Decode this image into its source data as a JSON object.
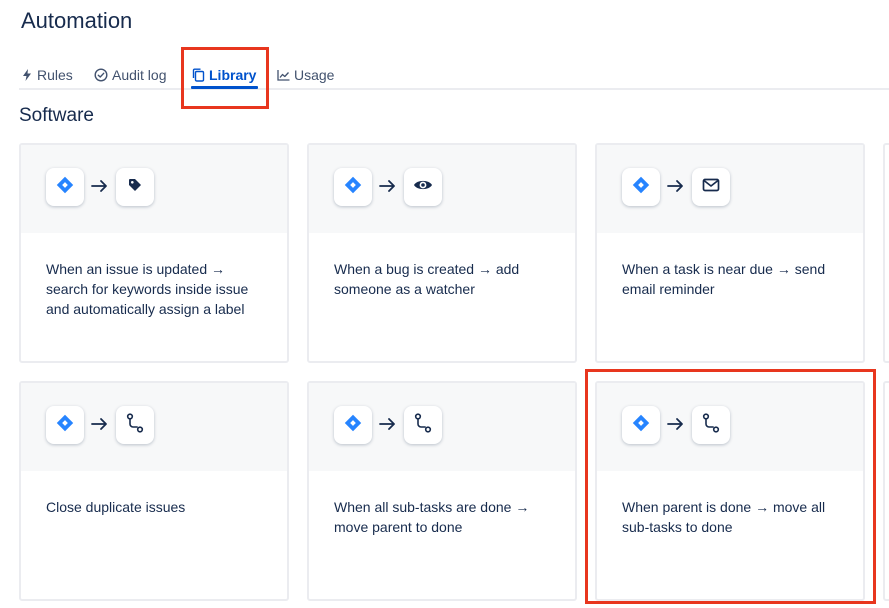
{
  "page": {
    "title": "Automation"
  },
  "tabs": [
    {
      "label": "Rules",
      "icon": "lightning-icon",
      "active": false
    },
    {
      "label": "Audit log",
      "icon": "check-circle-icon",
      "active": false
    },
    {
      "label": "Library",
      "icon": "copy-icon",
      "active": true
    },
    {
      "label": "Usage",
      "icon": "chart-icon",
      "active": false
    }
  ],
  "section": {
    "title": "Software"
  },
  "cards": [
    {
      "trigger_icon": "jira-diamond-icon",
      "action_icon": "tag-icon",
      "description": "When an issue is updated → search for keywords inside issue and automatically assign a label"
    },
    {
      "trigger_icon": "jira-diamond-icon",
      "action_icon": "eye-icon",
      "description": "When a bug is created → add someone as a watcher"
    },
    {
      "trigger_icon": "jira-diamond-icon",
      "action_icon": "envelope-icon",
      "description": "When a task is near due → send email reminder"
    },
    {
      "trigger_icon": "jira-diamond-icon",
      "action_icon": "transition-icon",
      "description": "Close duplicate issues"
    },
    {
      "trigger_icon": "jira-diamond-icon",
      "action_icon": "transition-icon",
      "description": "When all sub-tasks are done → move parent to done"
    },
    {
      "trigger_icon": "jira-diamond-icon",
      "action_icon": "transition-icon",
      "description": "When parent is done → move all sub-tasks to done"
    }
  ],
  "colors": {
    "accent": "#0052cc",
    "jira_blue": "#2684ff",
    "highlight": "#e8361e",
    "card_border": "#ebecf0"
  }
}
